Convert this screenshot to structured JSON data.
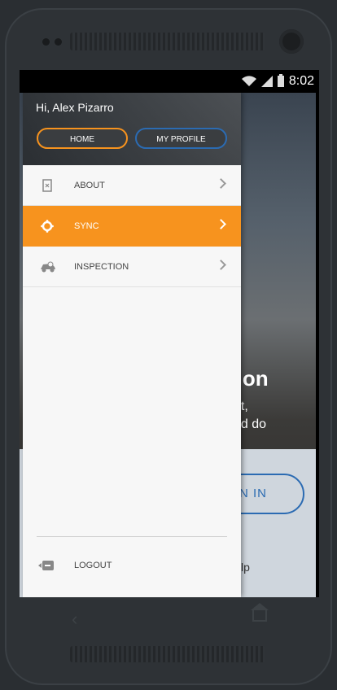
{
  "status_bar": {
    "time": "8:02"
  },
  "drawer": {
    "greeting": "Hi, Alex Pizarro",
    "home_button": "HOME",
    "profile_button": "MY PROFILE",
    "items": [
      {
        "label": "ABOUT",
        "icon": "about-icon"
      },
      {
        "label": "SYNC",
        "icon": "sync-icon",
        "active": true
      },
      {
        "label": "INSPECTION",
        "icon": "inspection-icon"
      }
    ],
    "logout_label": "LOGOUT"
  },
  "background": {
    "title_fragment": "tion",
    "line1_fragment": "et,",
    "line2_fragment": "ed do",
    "signin_fragment": "N IN",
    "help_fragment": "lp"
  },
  "colors": {
    "accent": "#f7931e",
    "brand_blue": "#2b6bb2"
  }
}
